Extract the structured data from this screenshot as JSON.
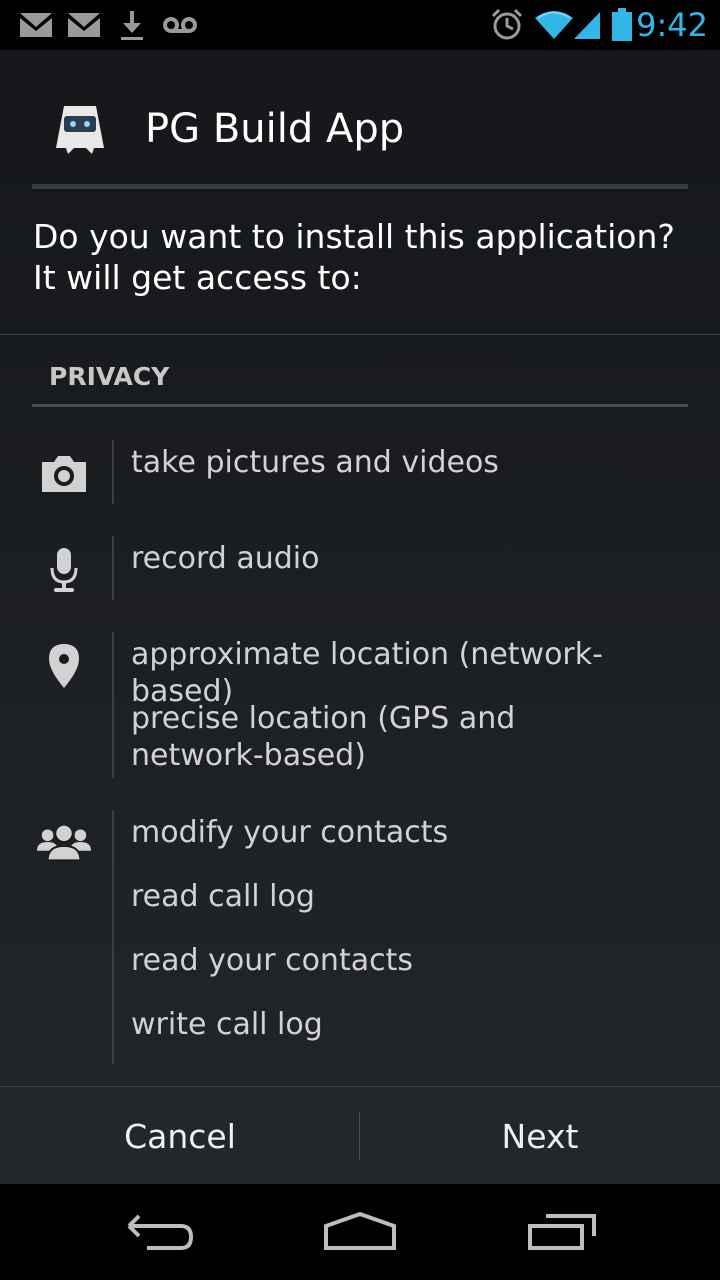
{
  "status_bar": {
    "time": "9:42",
    "icons": [
      "gmail-icon",
      "gmail-icon",
      "download-icon",
      "voicemail-icon",
      "alarm-icon",
      "wifi-icon",
      "signal-icon",
      "battery-icon"
    ]
  },
  "dialog": {
    "app_name": "PG Build App",
    "question": "Do you want to install this application? It will get access to:",
    "section_title": "PRIVACY",
    "groups": [
      {
        "icon": "camera-icon",
        "permissions": [
          "take pictures and videos"
        ]
      },
      {
        "icon": "microphone-icon",
        "permissions": [
          "record audio"
        ]
      },
      {
        "icon": "location-pin-icon",
        "permissions": [
          "approximate location (network-based)",
          "precise location (GPS and network-based)"
        ]
      },
      {
        "icon": "contacts-icon",
        "permissions": [
          "modify your contacts",
          "read call log",
          "read your contacts",
          "write call log"
        ]
      }
    ],
    "buttons": {
      "cancel": "Cancel",
      "next": "Next"
    }
  },
  "nav_bar": {
    "icons": [
      "back-icon",
      "home-icon",
      "recents-icon"
    ]
  },
  "colors": {
    "accent": "#33b5e5",
    "background": "#1d2024"
  }
}
